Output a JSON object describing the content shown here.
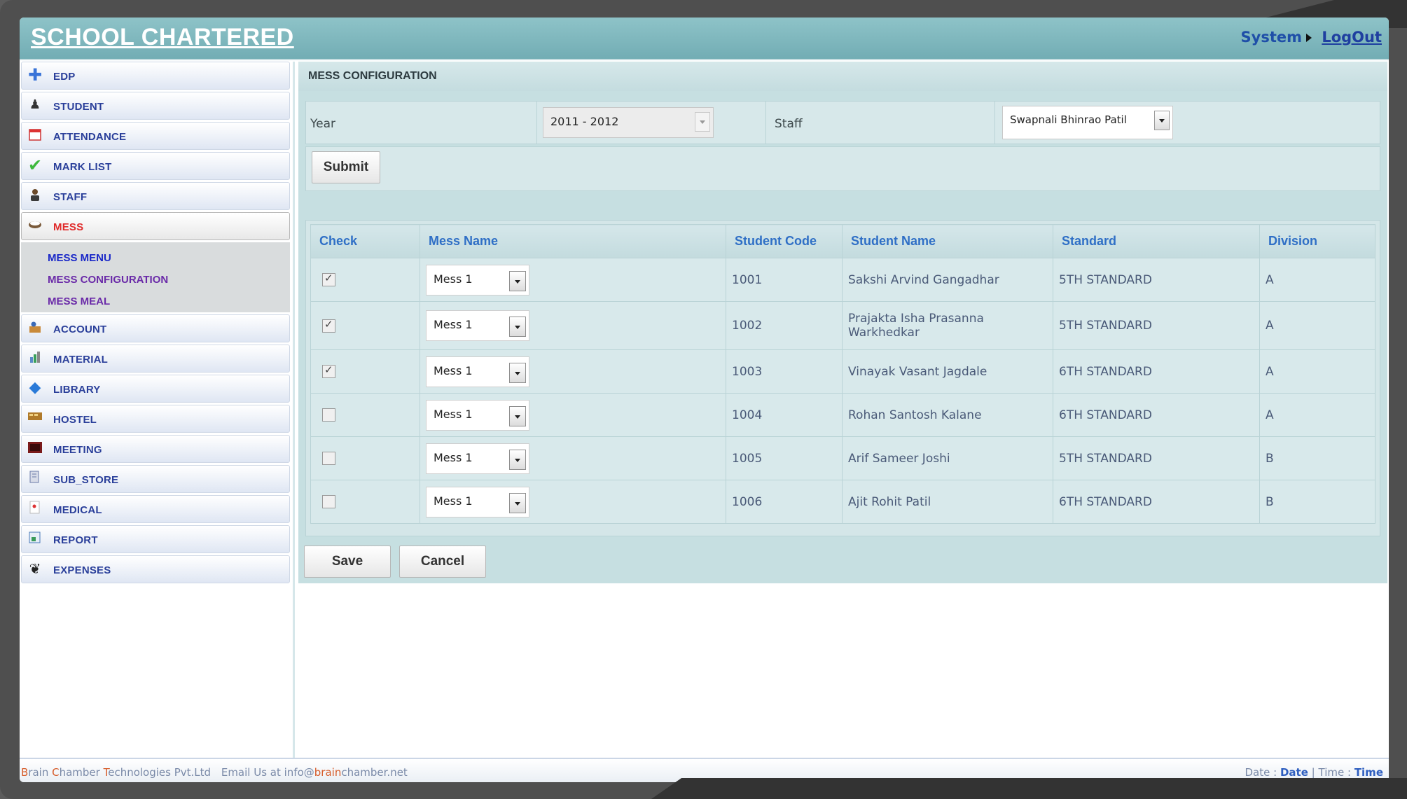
{
  "app": {
    "title": "SCHOOL CHARTERED",
    "system_label": "System",
    "logout_label": "LogOut"
  },
  "colors": {
    "header": "#7fb8be",
    "nav_text": "#2a3f9a",
    "active_nav": "#e02a2a",
    "table_header_text": "#2f6fc6"
  },
  "sidebar": {
    "items": [
      {
        "label": "EDP",
        "icon": "plus-cross-icon"
      },
      {
        "label": "STUDENT",
        "icon": "student-icon"
      },
      {
        "label": "ATTENDANCE",
        "icon": "calendar-icon"
      },
      {
        "label": "MARK LIST",
        "icon": "checkmark-icon"
      },
      {
        "label": "STAFF",
        "icon": "staff-person-icon"
      },
      {
        "label": "MESS",
        "icon": "food-bowl-icon",
        "active": true
      },
      {
        "label": "ACCOUNT",
        "icon": "account-icon"
      },
      {
        "label": "MATERIAL",
        "icon": "material-icon"
      },
      {
        "label": "LIBRARY",
        "icon": "library-book-icon"
      },
      {
        "label": "HOSTEL",
        "icon": "hostel-icon"
      },
      {
        "label": "MEETING",
        "icon": "meeting-board-icon"
      },
      {
        "label": "SUB_STORE",
        "icon": "store-icon"
      },
      {
        "label": "MEDICAL",
        "icon": "medical-icon"
      },
      {
        "label": "REPORT",
        "icon": "report-icon"
      },
      {
        "label": "EXPENSES",
        "icon": "expenses-icon"
      }
    ],
    "submenu": [
      "MESS MENU",
      "MESS CONFIGURATION",
      "MESS MEAL"
    ]
  },
  "page": {
    "title": "MESS CONFIGURATION",
    "year_label": "Year",
    "year_value": "2011 - 2012",
    "staff_label": "Staff",
    "staff_value": "Swapnali Bhinrao Patil",
    "submit_label": "Submit",
    "save_label": "Save",
    "cancel_label": "Cancel"
  },
  "table": {
    "headers": [
      "Check",
      "Mess Name",
      "Student Code",
      "Student Name",
      "Standard",
      "Division"
    ],
    "rows": [
      {
        "checked": true,
        "mess": "Mess 1",
        "code": "1001",
        "name": "Sakshi Arvind Gangadhar",
        "standard": "5TH STANDARD",
        "division": "A"
      },
      {
        "checked": true,
        "mess": "Mess 1",
        "code": "1002",
        "name": "Prajakta Isha Prasanna Warkhedkar",
        "standard": "5TH STANDARD",
        "division": "A"
      },
      {
        "checked": true,
        "mess": "Mess 1",
        "code": "1003",
        "name": "Vinayak Vasant Jagdale",
        "standard": "6TH STANDARD",
        "division": "A"
      },
      {
        "checked": false,
        "mess": "Mess 1",
        "code": "1004",
        "name": "Rohan Santosh Kalane",
        "standard": "6TH STANDARD",
        "division": "A"
      },
      {
        "checked": false,
        "mess": "Mess 1",
        "code": "1005",
        "name": "Arif Sameer Joshi",
        "standard": "5TH STANDARD",
        "division": "B"
      },
      {
        "checked": false,
        "mess": "Mess 1",
        "code": "1006",
        "name": "Ajit Rohit Patil",
        "standard": "6TH STANDARD",
        "division": "B"
      }
    ]
  },
  "footer": {
    "company_b": "B",
    "company_rest1": "rain ",
    "company_c": "C",
    "company_rest2": "hamber ",
    "company_t": "T",
    "company_rest3": "echnologies Pvt.Ltd",
    "email_prefix": "Email Us at info@",
    "email_brain": "brain",
    "email_suffix": "chamber.net",
    "date_label": "Date :",
    "date_value": "Date",
    "sep": "|",
    "time_label": "Time :",
    "time_value": "Time"
  }
}
